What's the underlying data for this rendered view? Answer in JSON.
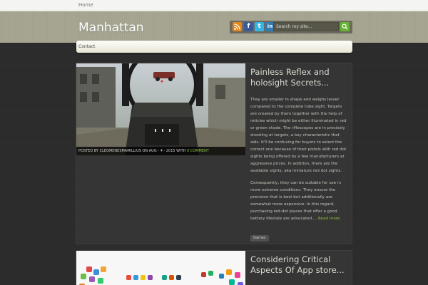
{
  "topbar": {
    "home_label": "Home"
  },
  "header": {
    "site_title": "Manhattan",
    "search_placeholder": "Search my site...",
    "social": [
      "rss-icon",
      "facebook-icon",
      "twitter-icon",
      "linkedin-icon"
    ]
  },
  "menu": {
    "items": [
      {
        "label": "Contact"
      }
    ]
  },
  "colors": {
    "accent": "#8dc63f",
    "header_bg": "#a7a693",
    "body_bg": "#2b2b2b"
  },
  "posts": [
    {
      "title": "Painless Reflex and holosight Secrets...",
      "meta_prefix": "POSTED BY CLEOMENESMAMILLIUS ON AUG - 4 - 2015 WITH ",
      "meta_comments": "0 COMMENT",
      "excerpt_1": "They are smaller in shape and weighs lesser compared to the complete tube sight. Targets are created by them together with the help of reticles which might be either illuminated in red or green shade. The riflescopes are in precisely shooting at targets, a key characteristic that aids. It'll be confusing for buyers to select the correct one because of their pistols with red dot sights being offered by a few manufacturers at aggressive prices. In addition, there are the available sights, aka miniature red dot sights.",
      "excerpt_2": "Consequently, they can be suitable for use in more extreme conditions. They ensure the precision that is best but additionally are somewhat more expensive. In this regard, purchasing red-dot places that offer a good battery lifestyle are advocated....",
      "read_more": "Read more",
      "tag": "Games"
    },
    {
      "title": "Considering Critical Aspects Of App store..."
    }
  ]
}
